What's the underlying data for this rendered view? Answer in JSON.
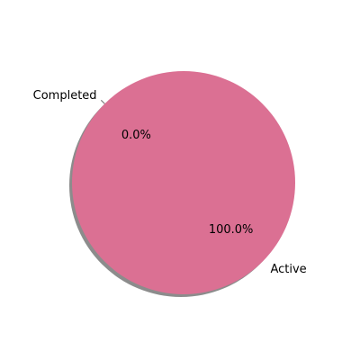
{
  "chart_data": {
    "type": "pie",
    "categories": [
      "Completed",
      "Active"
    ],
    "values": [
      0,
      100
    ],
    "percent_labels": [
      "0.0%",
      "100.0%"
    ],
    "colors": [
      "#6c8ebf",
      "#db7093"
    ],
    "shadow": true,
    "start_angle_deg": 135,
    "legend": "none"
  }
}
